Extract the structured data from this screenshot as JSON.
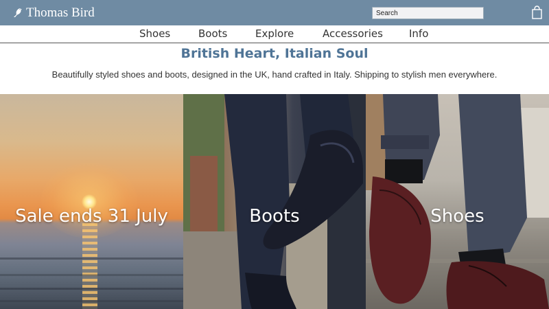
{
  "brand": {
    "name": "Thomas Bird",
    "logo_icon": "bird-icon"
  },
  "header": {
    "search_placeholder": "Search",
    "bag_icon": "shopping-bag-icon",
    "background": "#6f8ba3"
  },
  "nav": {
    "items": [
      {
        "label": "Shoes"
      },
      {
        "label": "Boots"
      },
      {
        "label": "Explore"
      },
      {
        "label": "Accessories"
      },
      {
        "label": "Info"
      }
    ]
  },
  "hero": {
    "headline": "British Heart, Italian Soul",
    "tagline": "Beautifully styled shoes and boots, designed in the UK, hand crafted in Italy. Shipping to stylish men everywhere.",
    "headline_color": "#4f7496"
  },
  "tiles": [
    {
      "label": "Sale ends 31 July",
      "image": "sunset over sea"
    },
    {
      "label": "Boots",
      "image": "man wearing dark chelsea boots"
    },
    {
      "label": "Shoes",
      "image": "man wearing burgundy oxford shoes"
    }
  ]
}
